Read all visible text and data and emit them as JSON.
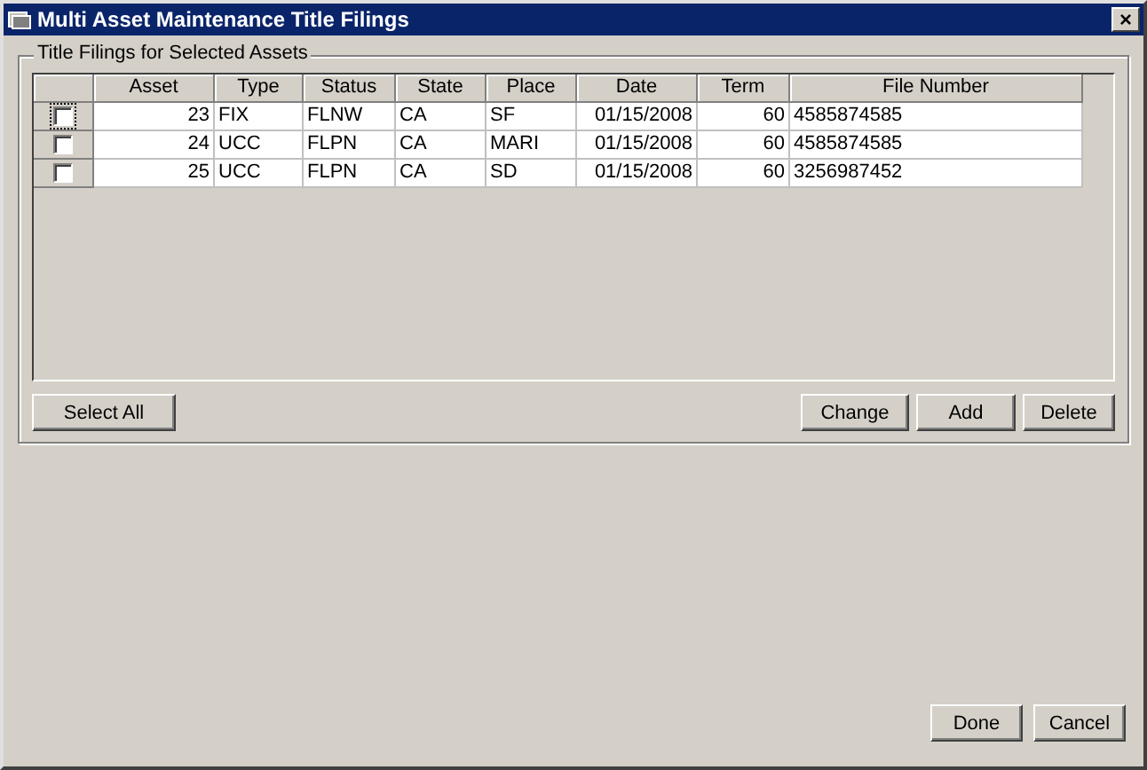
{
  "window": {
    "title": "Multi Asset Maintenance Title Filings",
    "close": "×"
  },
  "group": {
    "title": "Title Filings for Selected Assets"
  },
  "table": {
    "columns": [
      "Asset",
      "Type",
      "Status",
      "State",
      "Place",
      "Date",
      "Term",
      "File Number"
    ],
    "rows": [
      {
        "checked": false,
        "focused": true,
        "cells": [
          "23",
          "FIX",
          "FLNW",
          "CA",
          "SF",
          "01/15/2008",
          "60",
          "4585874585"
        ]
      },
      {
        "checked": false,
        "focused": false,
        "cells": [
          "24",
          "UCC",
          "FLPN",
          "CA",
          "MARI",
          "01/15/2008",
          "60",
          "4585874585"
        ]
      },
      {
        "checked": false,
        "focused": false,
        "cells": [
          "25",
          "UCC",
          "FLPN",
          "CA",
          "SD",
          "01/15/2008",
          "60",
          "3256987452"
        ]
      }
    ]
  },
  "left_buttons": [
    "Select All"
  ],
  "right_buttons": [
    "Change",
    "Add",
    "Delete"
  ],
  "footer_buttons": [
    "Done",
    "Cancel"
  ]
}
